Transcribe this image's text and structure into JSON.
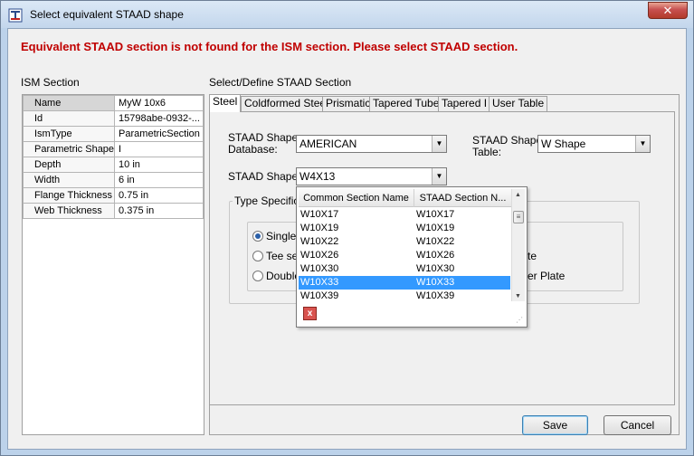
{
  "window": {
    "title": "Select equivalent STAAD shape",
    "close_glyph": "✕"
  },
  "warning": "Equivalent STAAD section is not found for the ISM section. Please select STAAD section.",
  "ism_section": {
    "label": "ISM Section",
    "rows": [
      {
        "key": "Name",
        "value": "MyW 10x6"
      },
      {
        "key": "Id",
        "value": "15798abe-0932-..."
      },
      {
        "key": "IsmType",
        "value": "ParametricSection"
      },
      {
        "key": "Parametric Shape",
        "value": "I"
      },
      {
        "key": "Depth",
        "value": "10 in"
      },
      {
        "key": "Width",
        "value": "6 in"
      },
      {
        "key": "Flange Thickness",
        "value": "0.75 in"
      },
      {
        "key": "Web Thickness",
        "value": "0.375 in"
      }
    ]
  },
  "staad_section": {
    "label": "Select/Define STAAD Section",
    "tabs": [
      "Steel",
      "Coldformed Steel",
      "Prismatic",
      "Tapered Tube",
      "Tapered I",
      "User Table"
    ],
    "active_tab": "Steel",
    "database_label_1": "STAAD Shape",
    "database_label_2": "Database:",
    "database_value": "AMERICAN",
    "table_label_1": "STAAD Shape",
    "table_label_2": "Table:",
    "table_value": "W Shape",
    "shape_label": "STAAD Shape:",
    "shape_value": "W4X13",
    "type_spec_title": "Type Specifica",
    "radios": [
      {
        "label": "Single s",
        "checked": true
      },
      {
        "label": "Tee sec",
        "checked": false
      },
      {
        "label": "Double",
        "checked": false
      }
    ],
    "radios_right": [
      "te",
      "er Plate"
    ]
  },
  "dropdown": {
    "columns": [
      "Common Section Name",
      "STAAD Section N..."
    ],
    "rows": [
      {
        "common": "W10X17",
        "staad": "W10X17"
      },
      {
        "common": "W10X19",
        "staad": "W10X19"
      },
      {
        "common": "W10X22",
        "staad": "W10X22"
      },
      {
        "common": "W10X26",
        "staad": "W10X26"
      },
      {
        "common": "W10X30",
        "staad": "W10X30"
      },
      {
        "common": "W10X33",
        "staad": "W10X33",
        "selected": true
      },
      {
        "common": "W10X39",
        "staad": "W10X39"
      }
    ],
    "close_glyph": "x"
  },
  "buttons": {
    "save": "Save",
    "cancel": "Cancel"
  },
  "colors": {
    "warning": "#c00000",
    "selection": "#3399ff"
  }
}
